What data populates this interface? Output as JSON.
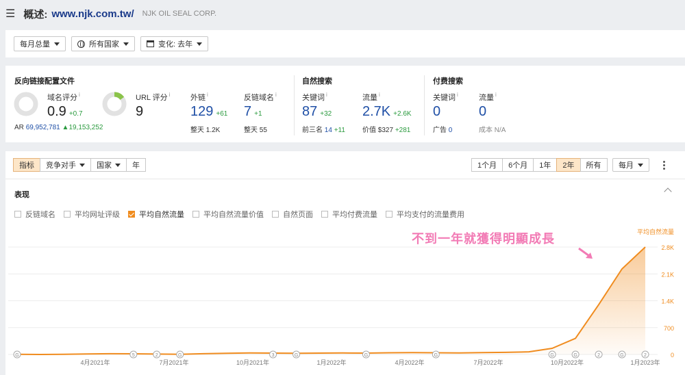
{
  "header": {
    "title": "概述:",
    "domain": "www.njk.com.tw/",
    "company": "NJK OIL SEAL CORP."
  },
  "filters": {
    "monthly": "每月总量",
    "country": "所有国家",
    "change": "变化: 去年"
  },
  "backlinks": {
    "section_title": "反向链接配置文件",
    "dr_label": "域名评分",
    "dr_value": "0.9",
    "dr_delta": "+0.7",
    "ar_label": "AR",
    "ar_value": "69,952,781",
    "ar_delta": "19,153,252",
    "ur_label": "URL 评分",
    "ur_value": "9",
    "ext_label": "外链",
    "ext_value": "129",
    "ext_delta": "+61",
    "ext_sub_label": "整天",
    "ext_sub_value": "1.2K",
    "rd_label": "反链域名",
    "rd_value": "7",
    "rd_delta": "+1",
    "rd_sub_label": "整天",
    "rd_sub_value": "55"
  },
  "organic": {
    "section_title": "自然搜索",
    "kw_label": "关键词",
    "kw_value": "87",
    "kw_delta": "+32",
    "top3_label": "前三名",
    "top3_value": "14",
    "top3_delta": "+11",
    "traffic_label": "流量",
    "traffic_value": "2.7K",
    "traffic_delta": "+2.6K",
    "value_label": "价值",
    "value_value": "$327",
    "value_delta": "+281"
  },
  "paid": {
    "section_title": "付费搜索",
    "kw_label": "关键词",
    "kw_value": "0",
    "ads_label": "广告",
    "ads_value": "0",
    "traffic_label": "流量",
    "traffic_value": "0",
    "cost_label": "成本",
    "cost_value": "N/A"
  },
  "chart_tabs": {
    "metrics": "指标",
    "competitors": "竞争对手",
    "country": "国家",
    "year": "年"
  },
  "ranges": [
    "1个月",
    "6个月",
    "1年",
    "2年",
    "所有"
  ],
  "range_active": "2年",
  "period_select": "每月",
  "performance_title": "表现",
  "checkboxes": [
    {
      "label": "反链域名",
      "checked": false
    },
    {
      "label": "平均网址评级",
      "checked": false
    },
    {
      "label": "平均自然流量",
      "checked": true
    },
    {
      "label": "平均自然流量价值",
      "checked": false
    },
    {
      "label": "自然页面",
      "checked": false
    },
    {
      "label": "平均付费流量",
      "checked": false
    },
    {
      "label": "平均支付的流量费用",
      "checked": false
    }
  ],
  "annotation": "不到一年就獲得明顯成長",
  "colors": {
    "accent": "#f08c1f",
    "annotation": "#f27bb5",
    "link": "#1f4fa6",
    "positive": "#2a9a3e"
  },
  "chart_data": {
    "type": "area",
    "series": [
      {
        "name": "平均自然流量",
        "values": [
          5,
          0,
          5,
          15,
          20,
          18,
          10,
          5,
          20,
          30,
          40,
          35,
          30,
          35,
          40,
          35,
          45,
          50,
          45,
          40,
          50,
          55,
          70,
          160,
          420,
          1300,
          2230,
          2800
        ]
      }
    ],
    "x_tick_labels": [
      "4月2021年",
      "7月2021年",
      "10月2021年",
      "1月2022年",
      "4月2022年",
      "7月2022年",
      "10月2022年",
      "1月2023年"
    ],
    "y_tick_labels": [
      "0",
      "700",
      "1.4K",
      "2.1K",
      "2.8K"
    ],
    "ylim": [
      0,
      3000
    ],
    "ylabel": "平均自然流量",
    "markers": [
      {
        "i": 0,
        "label": "G"
      },
      {
        "i": 5,
        "label": "5"
      },
      {
        "i": 6,
        "label": "2"
      },
      {
        "i": 7,
        "label": "G"
      },
      {
        "i": 11,
        "label": "3"
      },
      {
        "i": 12,
        "label": "G"
      },
      {
        "i": 15,
        "label": "G"
      },
      {
        "i": 18,
        "label": "G"
      },
      {
        "i": 23,
        "label": "G"
      },
      {
        "i": 24,
        "label": "G"
      },
      {
        "i": 25,
        "label": "2"
      },
      {
        "i": 26,
        "label": "G"
      },
      {
        "i": 27,
        "label": "2"
      }
    ],
    "grid": true
  }
}
